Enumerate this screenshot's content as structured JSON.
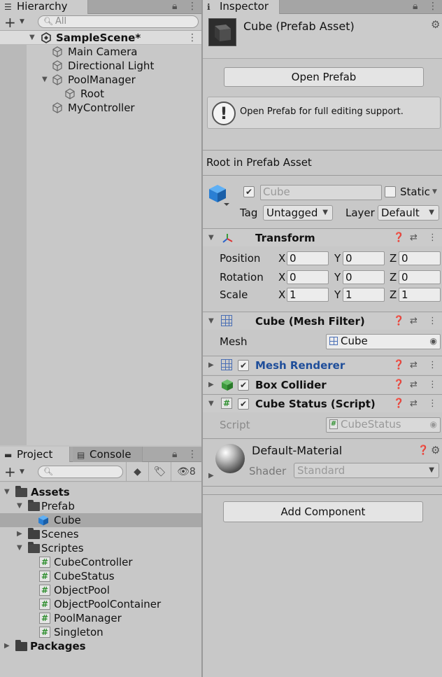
{
  "hierarchy": {
    "tab_label": "Hierarchy",
    "search_placeholder": "All",
    "scene": "SampleScene*",
    "items": [
      {
        "label": "Main Camera"
      },
      {
        "label": "Directional Light"
      },
      {
        "label": "PoolManager"
      },
      {
        "label": "Root"
      },
      {
        "label": "MyController"
      }
    ]
  },
  "project": {
    "tab_label": "Project",
    "console_label": "Console",
    "hidden_count": "8",
    "tree": [
      {
        "label": "Assets"
      },
      {
        "label": "Prefab"
      },
      {
        "label": "Cube"
      },
      {
        "label": "Scenes"
      },
      {
        "label": "Scriptes"
      },
      {
        "label": "CubeController"
      },
      {
        "label": "CubeStatus"
      },
      {
        "label": "ObjectPool"
      },
      {
        "label": "ObjectPoolContainer"
      },
      {
        "label": "PoolManager"
      },
      {
        "label": "Singleton"
      },
      {
        "label": "Packages"
      }
    ]
  },
  "inspector": {
    "tab_label": "Inspector",
    "asset_title": "Cube (Prefab Asset)",
    "open_prefab": "Open Prefab",
    "help_text": "Open Prefab for full editing support.",
    "root_label": "Root in Prefab Asset",
    "object_name": "Cube",
    "static_label": "Static",
    "tag_label": "Tag",
    "tag_value": "Untagged",
    "layer_label": "Layer",
    "layer_value": "Default",
    "transform": {
      "title": "Transform",
      "position_label": "Position",
      "rotation_label": "Rotation",
      "scale_label": "Scale",
      "x": "X",
      "y": "Y",
      "z": "Z",
      "position": [
        "0",
        "0",
        "0"
      ],
      "rotation": [
        "0",
        "0",
        "0"
      ],
      "scale": [
        "1",
        "1",
        "1"
      ]
    },
    "mesh_filter": {
      "title": "Cube (Mesh Filter)",
      "mesh_label": "Mesh",
      "mesh_value": "Cube"
    },
    "mesh_renderer": {
      "title": "Mesh Renderer"
    },
    "box_collider": {
      "title": "Box Collider"
    },
    "cube_status": {
      "title": "Cube Status (Script)",
      "script_label": "Script",
      "script_value": "CubeStatus"
    },
    "material": {
      "name": "Default-Material",
      "shader_label": "Shader",
      "shader_value": "Standard"
    },
    "add_component": "Add Component"
  },
  "colors": {
    "accent_blue": "#1f4e9a",
    "selection": "#a8a8a8"
  }
}
